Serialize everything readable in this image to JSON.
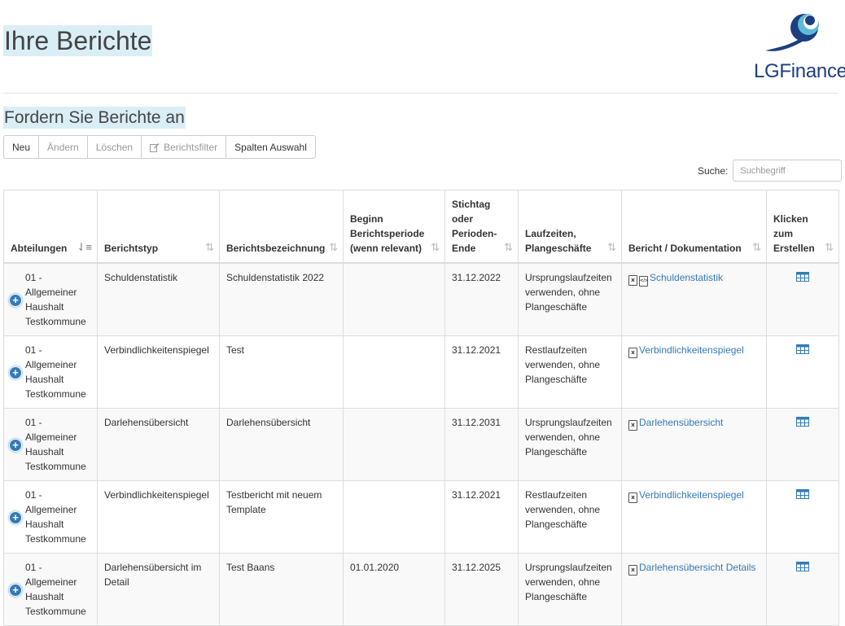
{
  "header": {
    "title": "Ihre Berichte",
    "logo_text": "LGFinance",
    "colors": {
      "brand_dark": "#1d3f7f",
      "brand_light": "#5fb9d9",
      "highlight": "#daeef6",
      "link": "#337ab7"
    }
  },
  "section": {
    "title": "Fordern Sie Berichte an"
  },
  "toolbar": {
    "buttons": [
      {
        "label": "Neu",
        "disabled": false
      },
      {
        "label": "Ändern",
        "disabled": true
      },
      {
        "label": "Löschen",
        "disabled": true
      },
      {
        "label": "Berichtsfilter",
        "disabled": true,
        "icon": "edit-icon"
      },
      {
        "label": "Spalten Auswahl",
        "disabled": false
      }
    ]
  },
  "search": {
    "label": "Suche:",
    "placeholder": "Suchbegriff",
    "value": ""
  },
  "table": {
    "columns": [
      {
        "label": "Abteilungen",
        "sort": "asc"
      },
      {
        "label": "Berichtstyp",
        "sort": "none"
      },
      {
        "label": "Berichtsbezeichnung",
        "sort": "none"
      },
      {
        "label": "Beginn Berichtsperiode (wenn relevant)",
        "sort": "none"
      },
      {
        "label": "Stichtag oder Perioden-Ende",
        "sort": "none"
      },
      {
        "label": "Laufzeiten, Plangeschäfte",
        "sort": "none"
      },
      {
        "label": "Bericht / Dokumentation",
        "sort": "none"
      },
      {
        "label": "Klicken zum Erstellen",
        "sort": "none"
      }
    ],
    "rows": [
      {
        "dept": "01 - Allgemeiner Haushalt Testkommune",
        "type": "Schuldenstatistik",
        "name": "Schuldenstatistik 2022",
        "start": "",
        "end": "31.12.2022",
        "terms": "Ursprungslaufzeiten verwenden, ohne Plangeschäfte",
        "doc": "Schuldenstatistik",
        "doc_icons": [
          "excel-file-icon",
          "code-file-icon"
        ]
      },
      {
        "dept": "01 - Allgemeiner Haushalt Testkommune",
        "type": "Verbindlichkeitenspiegel",
        "name": "Test",
        "start": "",
        "end": "31.12.2021",
        "terms": "Restlaufzeiten verwenden, ohne Plangeschäfte",
        "doc": "Verbindlichkeitenspiegel",
        "doc_icons": [
          "excel-file-icon"
        ]
      },
      {
        "dept": "01 - Allgemeiner Haushalt Testkommune",
        "type": "Darlehensübersicht",
        "name": "Darlehensübersicht",
        "start": "",
        "end": "31.12.2031",
        "terms": "Ursprungslaufzeiten verwenden, ohne Plangeschäfte",
        "doc": "Darlehensübersicht",
        "doc_icons": [
          "excel-file-icon"
        ]
      },
      {
        "dept": "01 - Allgemeiner Haushalt Testkommune",
        "type": "Verbindlichkeitenspiegel",
        "name": "Testbericht mit neuem Template",
        "start": "",
        "end": "31.12.2021",
        "terms": "Restlaufzeiten verwenden, ohne Plangeschäfte",
        "doc": "Verbindlichkeitenspiegel",
        "doc_icons": [
          "excel-file-icon"
        ]
      },
      {
        "dept": "01 - Allgemeiner Haushalt Testkommune",
        "type": "Darlehensübersicht im Detail",
        "name": "Test Baans",
        "start": "01.01.2020",
        "end": "31.12.2025",
        "terms": "Ursprungslaufzeiten verwenden, ohne Plangeschäfte",
        "doc": "Darlehensübersicht Details",
        "doc_icons": [
          "excel-file-icon"
        ]
      }
    ]
  }
}
